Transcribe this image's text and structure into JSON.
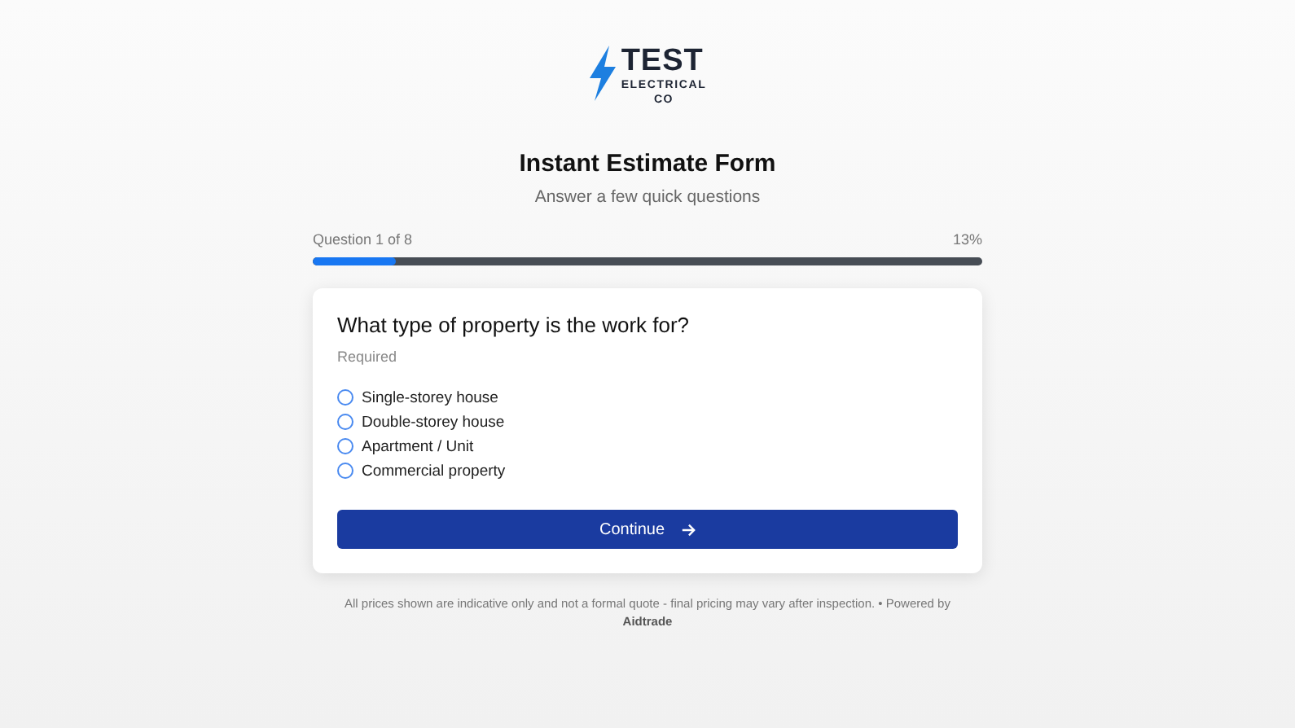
{
  "logo": {
    "word": "TEST",
    "line_2": "ELECTRICAL",
    "line_3": "CO"
  },
  "title": "Instant Estimate Form",
  "subtitle": "Answer a few quick questions",
  "progress": {
    "label": "Question 1 of 8",
    "percent": "13%",
    "level": 0.125
  },
  "question": {
    "text": "What type of property is the work for?",
    "hint": "Required",
    "options": [
      {
        "label": "Single-storey house",
        "selected": false
      },
      {
        "label": "Double-storey house",
        "selected": false
      },
      {
        "label": "Apartment / Unit",
        "selected": false
      },
      {
        "label": "Commercial property",
        "selected": false
      }
    ]
  },
  "continue_button": "Continue",
  "footer": "All prices shown are indicative only and not a formal quote - final pricing may vary after inspection. • Powered by **Aidtrade**"
}
